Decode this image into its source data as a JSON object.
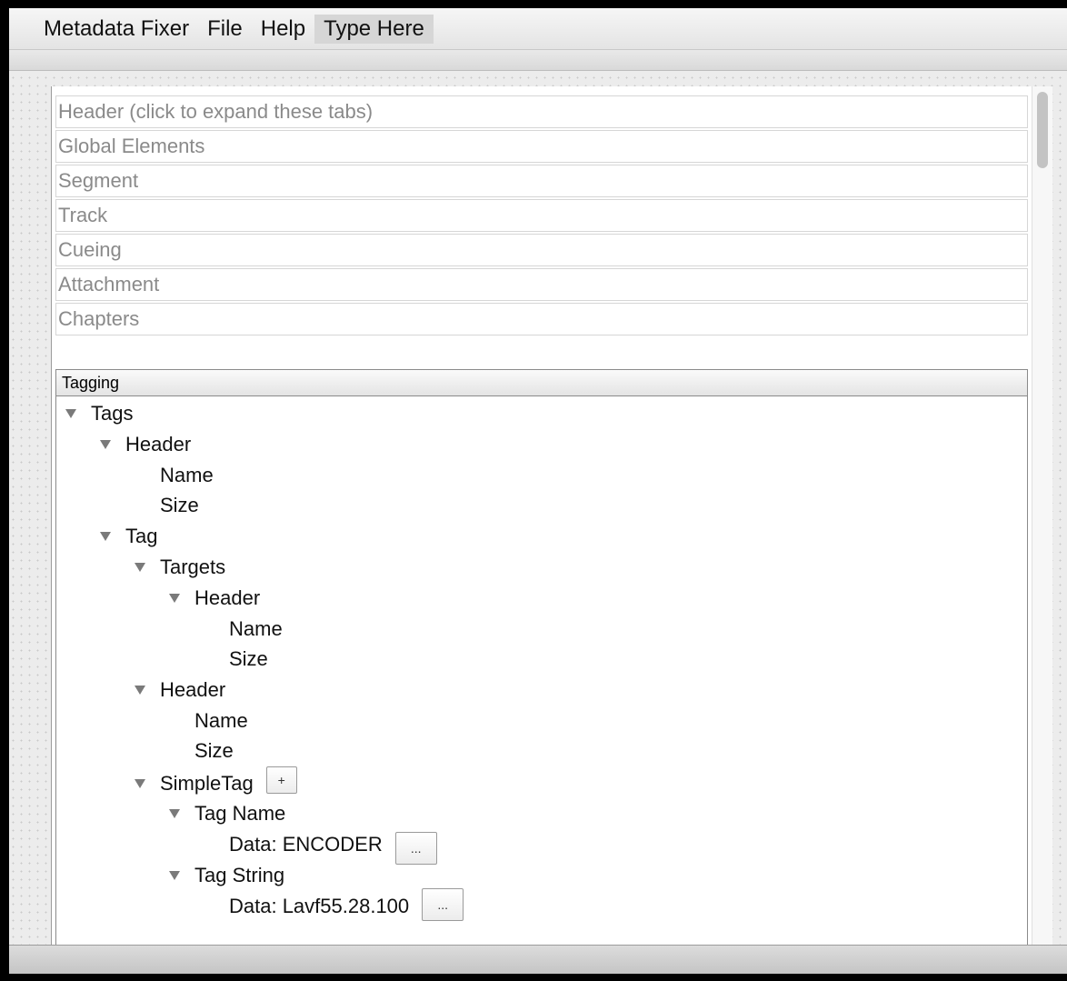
{
  "menubar": {
    "items": [
      "Metadata Fixer",
      "File",
      "Help",
      "Type Here"
    ]
  },
  "tabs": [
    "Header (click to expand these tabs)",
    "Global Elements",
    "Segment",
    "Track",
    "Cueing",
    "Attachment",
    "Chapters"
  ],
  "tagging": {
    "title": "Tagging",
    "tree": {
      "tags": "Tags",
      "header1": "Header",
      "name1": "Name",
      "size1": "Size",
      "tag": "Tag",
      "targets": "Targets",
      "header2": "Header",
      "name2": "Name",
      "size2": "Size",
      "header3": "Header",
      "name3": "Name",
      "size3": "Size",
      "simpletag": "SimpleTag",
      "add_button": "+",
      "tag_name": "Tag Name",
      "tag_name_data": "Data: ENCODER",
      "tag_name_edit": "...",
      "tag_string": "Tag String",
      "tag_string_data": "Data: Lavf55.28.100",
      "tag_string_edit": "..."
    }
  }
}
